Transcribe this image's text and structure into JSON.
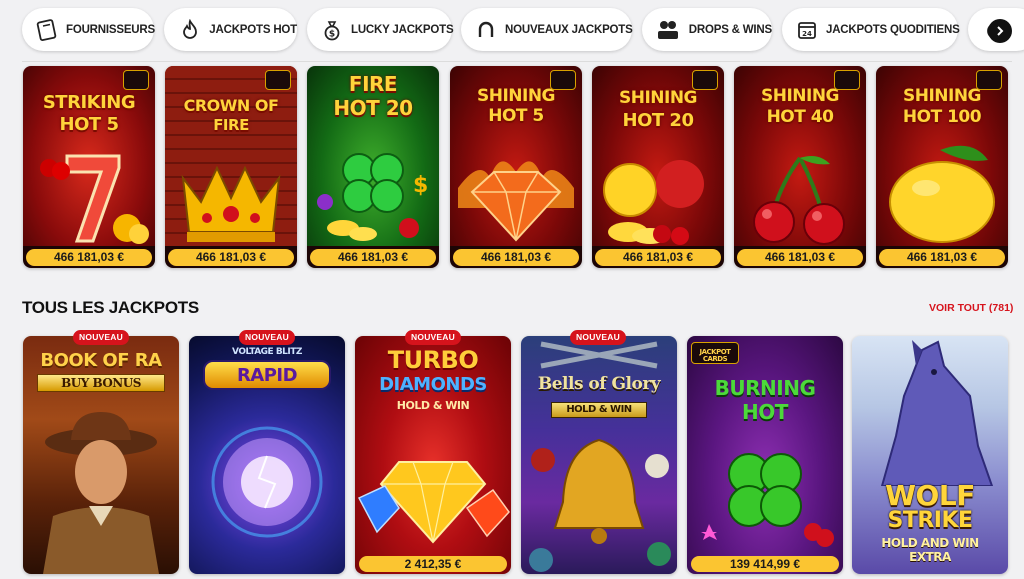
{
  "categories": [
    {
      "label": "FOURNISSEURS",
      "icon": "book-icon"
    },
    {
      "label": "JACKPOTS HOT",
      "icon": "flame-icon"
    },
    {
      "label": "LUCKY JACKPOTS",
      "icon": "money-bag-icon"
    },
    {
      "label": "NOUVEAUX JACKPOTS",
      "icon": "horseshoe-icon"
    },
    {
      "label": "DROPS & WINS",
      "icon": "drops-wins-icon"
    },
    {
      "label": "JACKPOTS QUODITIENS",
      "icon": "calendar-icon"
    }
  ],
  "top_games": [
    {
      "title_lines": [
        "STRIKING",
        "HOT 5"
      ],
      "amount": "466 181,03 €"
    },
    {
      "title_lines": [
        "CROWN OF",
        "FIRE"
      ],
      "amount": "466 181,03 €"
    },
    {
      "title_lines": [
        "FIRE",
        "HOT 20"
      ],
      "amount": "466 181,03 €"
    },
    {
      "title_lines": [
        "SHINING",
        "HOT 5"
      ],
      "amount": "466 181,03 €"
    },
    {
      "title_lines": [
        "SHINING",
        "HOT 20"
      ],
      "amount": "466 181,03 €"
    },
    {
      "title_lines": [
        "SHINING",
        "HOT 40"
      ],
      "amount": "466 181,03 €"
    },
    {
      "title_lines": [
        "SHINING",
        "HOT 100"
      ],
      "amount": "466 181,03 €"
    }
  ],
  "section": {
    "title": "TOUS LES JACKPOTS",
    "see_all": "VOIR TOUT (781)"
  },
  "badge_label": "NOUVEAU",
  "all_games": [
    {
      "title_lines": [
        "BOOK OF RA",
        "BUY BONUS"
      ],
      "badge": true,
      "amount": ""
    },
    {
      "title_lines": [
        "VOLTAGE BLITZ",
        "RAPID"
      ],
      "badge": true,
      "amount": ""
    },
    {
      "title_lines": [
        "TURBO",
        "DIAMONDS",
        "HOLD & WIN"
      ],
      "badge": true,
      "amount": "2 412,35 €"
    },
    {
      "title_lines": [
        "Bells of Glory",
        "HOLD & WIN"
      ],
      "badge": true,
      "amount": ""
    },
    {
      "title_lines": [
        "JACKPOT CARDS",
        "BURNING",
        "HOT"
      ],
      "badge": false,
      "amount": "139 414,99 €"
    },
    {
      "title_lines": [
        "WOLF",
        "STRIKE",
        "HOLD AND WIN",
        "EXTRA"
      ],
      "badge": false,
      "amount": ""
    }
  ],
  "colors": {
    "accent": "#d6131c",
    "jackpot_pill": "#fbc531",
    "background": "#f1f1f3"
  }
}
